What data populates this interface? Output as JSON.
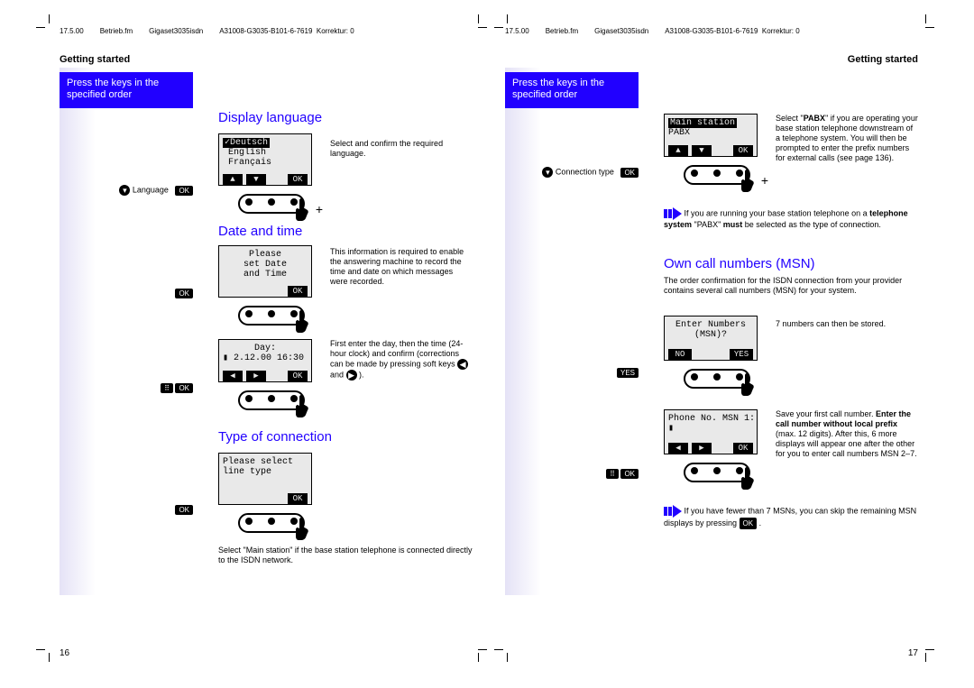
{
  "docmeta": {
    "date": "17.5.00",
    "file": "Betrieb.fm",
    "product": "Gigaset3035isdn",
    "doc_id": "A31008-G3035-B101-6-7619",
    "korrektur_label": "Korrektur:",
    "korrektur_val": "0"
  },
  "running_head": "Getting started",
  "strip": "Press the keys in the specified order",
  "page_left_num": "16",
  "page_right_num": "17",
  "sec_display_language": "Display language",
  "sec_date_time": "Date and time",
  "sec_type_connection": "Type of connection",
  "sec_own_msn": "Own call numbers (MSN)",
  "hint_language": "Language",
  "hint_conntype": "Connection type",
  "lcd_lang": {
    "l1": "✓Deutsch",
    "l2": " English",
    "l3": " Français"
  },
  "txt_lang_right": "Select and confirm the required language.",
  "lcd_datetime": {
    "l1": "Please",
    "l2": "set Date",
    "l3": "and Time"
  },
  "txt_datetime_right": "This information is required to enable the answering machine to record the time and date on which messages were recorded.",
  "lcd_day": {
    "l1": "Day:",
    "l2": "▮ 2.12.00 16:30"
  },
  "txt_day_right_a": "First enter the day, then the time (24-hour clock) and confirm (corrections can be made by pressing soft keys ",
  "txt_day_right_b": " and ",
  "txt_day_right_c": ").",
  "lcd_linetype": {
    "l1": "Please select",
    "l2": "line type"
  },
  "txt_linetype_note": "Select \"Main station\" if the base station telephone is connected directly to the ISDN network.",
  "lcd_mainpabx": {
    "l1": "Main station",
    "l2": "PABX"
  },
  "txt_pabx_right_a": "Select \"",
  "txt_pabx_right_b": "PABX",
  "txt_pabx_right_c": "\" if you are operating your base station telephone downstream of a telephone system. You will then be prompted to enter the prefix numbers for external calls (see page 136).",
  "note_pabx_a": "If you are running your base station telephone on a ",
  "note_pabx_b": "telephone system",
  "note_pabx_c": " \"PABX\" ",
  "note_pabx_d": "must",
  "note_pabx_e": " be selected as the type of connection.",
  "txt_msn_intro": "The order confirmation for the ISDN connection from your provider contains several call numbers (MSN) for your system.",
  "lcd_enternum": {
    "l1": "Enter Numbers",
    "l2": "(MSN)?"
  },
  "lcd_enternum_no": "NO",
  "lcd_enternum_yes": "YES",
  "txt_enternum_right": "7 numbers can then be stored.",
  "lcd_msn1": {
    "l1": "Phone No. MSN 1:",
    "l2": "▮"
  },
  "txt_msn1_right_a": "Save your first call number. ",
  "txt_msn1_right_b": "Enter the call number without local prefix",
  "txt_msn1_right_c": " (max. 12 digits). After this, 6 more displays will appear one after the other for you to enter call numbers MSN 2–7.",
  "note_skip_a": "If you have fewer than 7 MSNs, you can skip the remaining MSN displays by pressing ",
  "note_skip_b": ".",
  "label_ok": "OK",
  "label_yes": "YES"
}
